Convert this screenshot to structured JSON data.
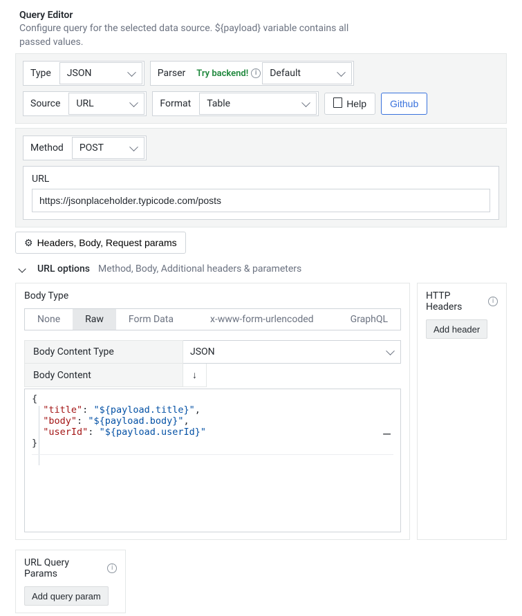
{
  "header": {
    "title": "Query Editor",
    "description": "Configure query for the selected data source. ${payload} variable contains all passed values."
  },
  "top": {
    "type_label": "Type",
    "type_value": "JSON",
    "parser_label": "Parser",
    "parser_try": "Try backend!",
    "parser_value": "Default",
    "source_label": "Source",
    "source_value": "URL",
    "format_label": "Format",
    "format_value": "Table",
    "help_label": "Help",
    "github_label": "Github"
  },
  "method": {
    "label": "Method",
    "value": "POST",
    "url_label": "URL",
    "url_value": "https://jsonplaceholder.typicode.com/posts"
  },
  "headers_btn": "Headers, Body, Request params",
  "url_options": {
    "title": "URL options",
    "desc": "Method, Body, Additional headers & parameters"
  },
  "body": {
    "type_label": "Body Type",
    "tabs": {
      "none": "None",
      "raw": "Raw",
      "form": "Form Data",
      "xwww": "x-www-form-urlencoded",
      "gql": "GraphQL"
    },
    "content_type_label": "Body Content Type",
    "content_type_value": "JSON",
    "content_label": "Body Content",
    "editor": {
      "l1": "{",
      "l2_key": "\"title\"",
      "l2_sep": ": ",
      "l2_val": "\"${payload.title}\"",
      "l2_end": ",",
      "l3_key": "\"body\"",
      "l3_sep": ": ",
      "l3_val": "\"${payload.body}\"",
      "l3_end": ",",
      "l4_key": "\"userId\"",
      "l4_sep": ": ",
      "l4_val": "\"${payload.userId}\"",
      "l5": "}"
    }
  },
  "http_headers": {
    "title": "HTTP Headers",
    "add": "Add header"
  },
  "query_params": {
    "title": "URL Query Params",
    "add": "Add query param"
  }
}
